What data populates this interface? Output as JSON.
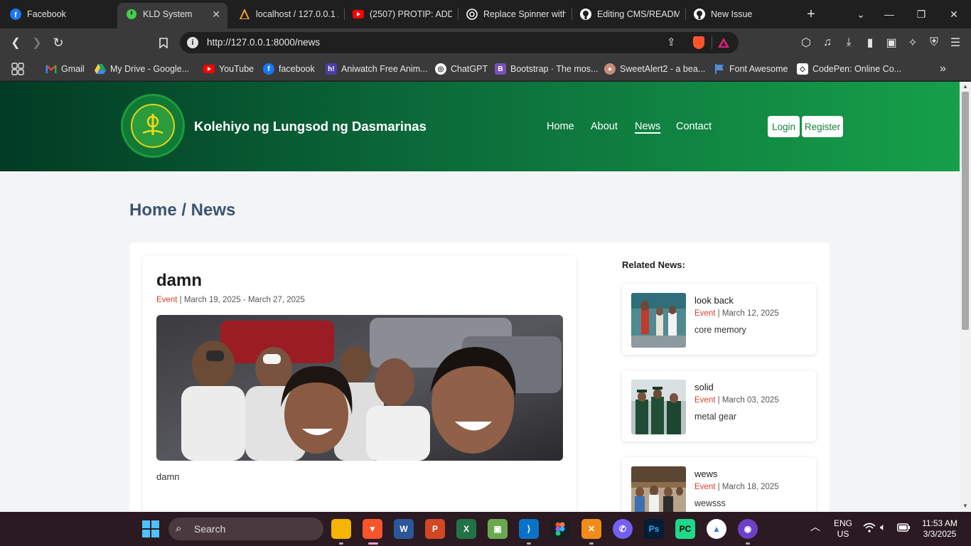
{
  "browser": {
    "tabs": [
      {
        "title": "Facebook",
        "icon": "facebook-icon",
        "color": "#1877f2"
      },
      {
        "title": "KLD System",
        "icon": "power-icon",
        "color": "#43d149",
        "active": true
      },
      {
        "title": "localhost / 127.0.0.1 /",
        "icon": "phpmyadmin-icon",
        "color": "#f0a22e"
      },
      {
        "title": "(2507) PROTIP: ADD",
        "icon": "youtube-icon",
        "color": "#ff0000"
      },
      {
        "title": "Replace Spinner with",
        "icon": "chatgpt-icon",
        "color": "#ffffff"
      },
      {
        "title": "Editing CMS/READM",
        "icon": "github-icon",
        "color": "#ffffff"
      },
      {
        "title": "New Issue",
        "icon": "github-icon",
        "color": "#ffffff"
      }
    ],
    "url": "http://127.0.0.1:8000/news",
    "bookmarks": [
      {
        "label": "Gmail",
        "icon": "gmail-icon",
        "color": "#ea4335"
      },
      {
        "label": "My Drive - Google...",
        "icon": "drive-icon",
        "color": "#1fa463"
      },
      {
        "label": "YouTube",
        "icon": "youtube-icon",
        "color": "#ff0000"
      },
      {
        "label": "facebook",
        "icon": "facebook-icon",
        "color": "#1877f2"
      },
      {
        "label": "Aniwatch Free Anim...",
        "icon": "aniwatch-icon",
        "color": "#6b5bd6"
      },
      {
        "label": "ChatGPT",
        "icon": "chatgpt-icon",
        "color": "#444444"
      },
      {
        "label": "Bootstrap · The mos...",
        "icon": "bootstrap-icon",
        "color": "#7952b3"
      },
      {
        "label": "SweetAlert2 - a bea...",
        "icon": "sweetalert-icon",
        "color": "#c78d7a"
      },
      {
        "label": "Font Awesome",
        "icon": "fontawesome-icon",
        "color": "#528dd7"
      },
      {
        "label": "CodePen: Online Co...",
        "icon": "codepen-icon",
        "color": "#222222"
      }
    ]
  },
  "site": {
    "name": "Kolehiyo ng Lungsod ng Dasmarinas",
    "nav": [
      "Home",
      "About",
      "News",
      "Contact"
    ],
    "active_nav": "News",
    "login_label": "Login",
    "register_label": "Register"
  },
  "breadcrumb": "Home / News",
  "article": {
    "title": "damn",
    "category": "Event",
    "dates": "March 19, 2025 - March 27, 2025",
    "body": "damn"
  },
  "related": {
    "heading": "Related News:",
    "items": [
      {
        "title": "look back",
        "category": "Event",
        "date": "March 12, 2025",
        "desc": "core memory"
      },
      {
        "title": "solid",
        "category": "Event",
        "date": "March 03, 2025",
        "desc": "metal gear"
      },
      {
        "title": "wews",
        "category": "Event",
        "date": "March 18, 2025",
        "desc": "wewsss"
      }
    ]
  },
  "taskbar": {
    "search_placeholder": "Search",
    "lang": "ENG",
    "region": "US",
    "time": "11:53 AM",
    "date": "3/3/2025"
  }
}
